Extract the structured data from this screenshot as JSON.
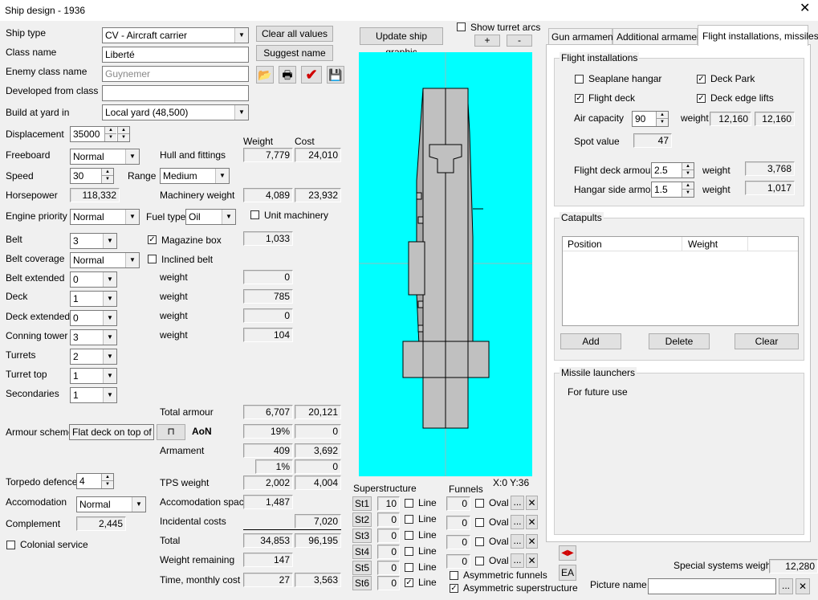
{
  "window": {
    "title": "Ship design - 1936"
  },
  "left": {
    "ship_type": {
      "label": "Ship type",
      "value": "CV - Aircraft carrier"
    },
    "class_name": {
      "label": "Class name",
      "value": "Liberté"
    },
    "enemy_class_name": {
      "label": "Enemy class name",
      "value": "Guynemer"
    },
    "developed_from": {
      "label": "Developed from class",
      "value": ""
    },
    "build_at_yard": {
      "label": "Build at yard in",
      "value": "Local yard (48,500)"
    },
    "displacement": {
      "label": "Displacement",
      "value": "35000"
    },
    "freeboard": {
      "label": "Freeboard",
      "value": "Normal"
    },
    "speed": {
      "label": "Speed",
      "value": "30"
    },
    "range": {
      "label": "Range",
      "value": "Medium"
    },
    "horsepower": {
      "label": "Horsepower",
      "value": "118,332"
    },
    "engine_priority": {
      "label": "Engine priority",
      "value": "Normal"
    },
    "fuel_type": {
      "label": "Fuel type",
      "value": "Oil"
    },
    "unit_machinery": {
      "label": "Unit machinery",
      "checked": false
    },
    "belt": {
      "label": "Belt",
      "value": "3"
    },
    "magazine_box": {
      "label": "Magazine box",
      "checked": true
    },
    "belt_coverage": {
      "label": "Belt coverage",
      "value": "Normal"
    },
    "inclined_belt": {
      "label": "Inclined belt",
      "checked": false
    },
    "belt_extended": {
      "label": "Belt extended",
      "value": "0"
    },
    "deck": {
      "label": "Deck",
      "value": "1"
    },
    "deck_extended": {
      "label": "Deck extended",
      "value": "0"
    },
    "conning_tower": {
      "label": "Conning tower",
      "value": "3"
    },
    "turrets": {
      "label": "Turrets",
      "value": "2"
    },
    "turret_top": {
      "label": "Turret top",
      "value": "1"
    },
    "secondaries": {
      "label": "Secondaries",
      "value": "1"
    },
    "armour_scheme": {
      "label": "Armour scheme",
      "value": "Flat deck on top of",
      "aon": "AoN"
    },
    "torpedo_defence": {
      "label": "Torpedo defence",
      "value": "4"
    },
    "accomodation": {
      "label": "Accomodation",
      "value": "Normal"
    },
    "complement": {
      "label": "Complement",
      "value": "2,445"
    },
    "colonial_service": {
      "label": "Colonial service",
      "checked": false
    }
  },
  "buttons": {
    "clear_all": "Clear all values",
    "suggest_name": "Suggest name",
    "update_graphic": "Update ship graphic",
    "show_turret_arcs": "Show turret arcs",
    "plus": "+",
    "minus": "-"
  },
  "stats": {
    "weight_header": "Weight",
    "cost_header": "Cost",
    "hull": {
      "label": "Hull and fittings",
      "weight": "7,779",
      "cost": "24,010"
    },
    "machinery": {
      "label": "Machinery weight",
      "weight": "4,089",
      "cost": "23,932"
    },
    "magazine_weight": "1,033",
    "w_label": "weight",
    "belt_ext_weight": "0",
    "deck_weight": "785",
    "deck_ext_weight": "0",
    "ct_weight": "104",
    "total_armour": {
      "label": "Total armour",
      "weight": "6,707",
      "cost": "20,121"
    },
    "armour_pct": "19%",
    "armour_pct_cost": "0",
    "armament": {
      "label": "Armament",
      "weight": "409",
      "cost": "3,692"
    },
    "armament_pct": "1%",
    "armament_pct_cost": "0",
    "tps": {
      "label": "TPS weight",
      "weight": "2,002",
      "cost": "4,004"
    },
    "accomodation_space": {
      "label": "Accomodation space",
      "weight": "1,487"
    },
    "incidental": {
      "label": "Incidental costs",
      "cost": "7,020"
    },
    "total": {
      "label": "Total",
      "weight": "34,853",
      "cost": "96,195"
    },
    "weight_remaining": {
      "label": "Weight remaining",
      "weight": "147"
    },
    "time_cost": {
      "label": "Time, monthly cost",
      "weight": "27",
      "cost": "3,563"
    }
  },
  "graphic": {
    "coords": "X:0 Y:36"
  },
  "superstructure": {
    "label": "Superstructure",
    "line_label": "Line",
    "rows": [
      {
        "btn": "St1",
        "value": "10",
        "line": false
      },
      {
        "btn": "St2",
        "value": "0",
        "line": false
      },
      {
        "btn": "St3",
        "value": "0",
        "line": false
      },
      {
        "btn": "St4",
        "value": "0",
        "line": false
      },
      {
        "btn": "St5",
        "value": "0",
        "line": false
      },
      {
        "btn": "St6",
        "value": "0",
        "line": true
      }
    ]
  },
  "funnels": {
    "label": "Funnels",
    "oval_label": "Oval",
    "ellipsis": "...",
    "x": "✕",
    "rows": [
      {
        "value": "0"
      },
      {
        "value": "0"
      },
      {
        "value": "0"
      },
      {
        "value": "0"
      }
    ],
    "asym_funnels": {
      "label": "Asymmetric funnels",
      "checked": false
    },
    "asym_super": {
      "label": "Asymmetric superstructure",
      "checked": true
    }
  },
  "tabs": [
    {
      "label": "Gun armament",
      "active": false
    },
    {
      "label": "Additional armament",
      "active": false
    },
    {
      "label": "Flight installations, missiles",
      "active": true
    }
  ],
  "flight": {
    "group": "Flight installations",
    "seaplane_hangar": {
      "label": "Seaplane hangar",
      "checked": false
    },
    "deck_park": {
      "label": "Deck Park",
      "checked": true
    },
    "flight_deck": {
      "label": "Flight deck",
      "checked": true
    },
    "deck_edge_lifts": {
      "label": "Deck edge lifts",
      "checked": true
    },
    "air_capacity": {
      "label": "Air capacity",
      "value": "90",
      "weight_label": "weight",
      "weight": "12,160",
      "cost": "12,160"
    },
    "spot_value": {
      "label": "Spot value",
      "value": "47"
    },
    "flight_deck_armour": {
      "label": "Flight deck armour",
      "value": "2.5",
      "weight_label": "weight",
      "weight": "3,768"
    },
    "hangar_side_armour": {
      "label": "Hangar side armour",
      "value": "1.5",
      "weight_label": "weight",
      "weight": "1,017"
    }
  },
  "catapults": {
    "group": "Catapults",
    "columns": [
      "Position",
      "Weight"
    ],
    "add": "Add",
    "delete": "Delete",
    "clear": "Clear"
  },
  "missiles": {
    "group": "Missile launchers",
    "text": "For future  use"
  },
  "bottom": {
    "ea": "EA",
    "special_systems": {
      "label": "Special systems weight",
      "value": "12,280"
    },
    "picture_name": {
      "label": "Picture name",
      "value": ""
    },
    "ellipsis": "...",
    "x": "✕"
  },
  "colors": {
    "graphic_bg": "#00ffff",
    "ship": "#c0c0c0",
    "accent_red": "#d00000"
  }
}
